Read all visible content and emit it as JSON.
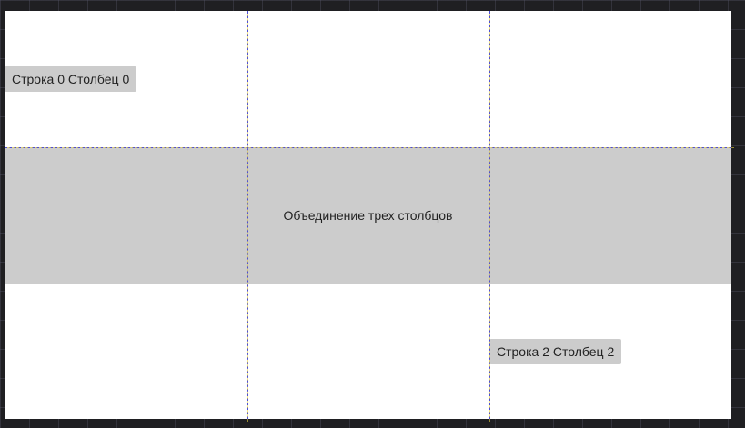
{
  "grid": {
    "items": {
      "row0_col0": "Строка 0 Столбец 0",
      "span_row1": "Объединение трех столбцов",
      "row2_col2": "Строка 2 Столбец 2"
    },
    "colors": {
      "background": "#1f1f22",
      "canvas": "#ffffff",
      "item_fill": "#cccccc",
      "grid_line": "#4c4cd8"
    }
  }
}
